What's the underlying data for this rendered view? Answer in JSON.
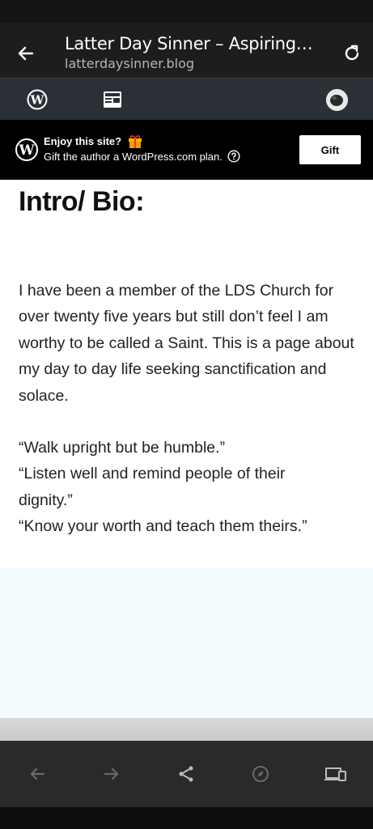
{
  "browser": {
    "title": "Latter Day Sinner – Aspiring…",
    "url": "latterdaysinner.blog",
    "icons": {
      "back": "arrow-left-icon",
      "reload": "reload-icon"
    }
  },
  "wpbar": {
    "icons": [
      "wordpress-logo-icon",
      "reader-icon",
      "avatar"
    ]
  },
  "banner": {
    "title": "Enjoy this site?",
    "subtitle": "Gift the author a WordPress.com plan.",
    "gift_label": "Gift",
    "accent_gift": "#f5b400"
  },
  "article": {
    "heading": "Intro/ Bio:",
    "paragraph": "I have been a member of the LDS Church for over twenty five years but still don’t feel I am worthy to be called a Saint. This is a page about my day to day life seeking sanctification and solace.",
    "quotes": [
      "“Walk upright but be humble.”",
      "“Listen well and remind people of their",
      "dignity.”",
      "“Know your worth and teach them theirs.”"
    ]
  },
  "colors": {
    "top_bar": "#1d1d1d",
    "wp_bar": "#2b3037",
    "banner_bg": "#000000",
    "footer_bg": "#f3fbfe"
  },
  "navbar": {
    "icons": [
      "back-arrow-icon",
      "forward-arrow-icon",
      "share-icon",
      "compass-icon",
      "devices-icon"
    ]
  }
}
